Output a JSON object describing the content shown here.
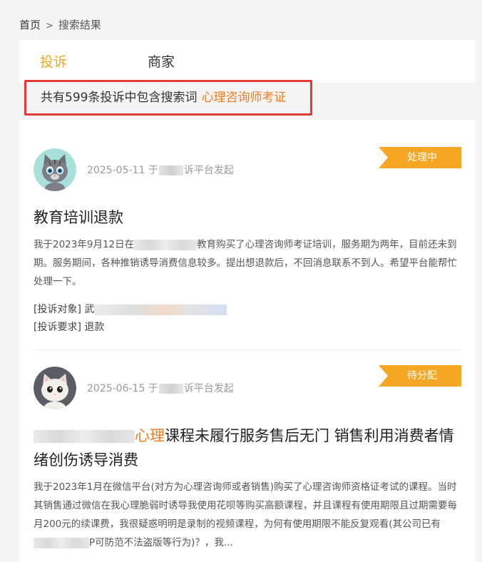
{
  "breadcrumb": {
    "home": "首页",
    "separator": ">",
    "current": "搜索结果"
  },
  "tabs": [
    {
      "label": "投诉",
      "active": true
    },
    {
      "label": "商家",
      "active": false
    }
  ],
  "summary": {
    "text": "共有599条投诉中包含搜索词",
    "keyword": "心理咨询师考证"
  },
  "colors": {
    "accent": "#f5a623",
    "keyword": "#f47c1e",
    "highlight_border": "#e53935"
  },
  "complaints": [
    {
      "avatar_icon": "cat-avatar-gray-icon",
      "date": "2025-05-11",
      "meta_prefix": "于",
      "meta_suffix": "诉平台发起",
      "status": "处理中",
      "title": "教育培训退款",
      "desc_part1": "我于2023年9月12日在",
      "desc_part2": "教育购买了心理咨询师考证培训，服务期为两年，目前还未到期。服务期间，各种推销诱导消费信息较多。提出想退款后，不回消息联系不到人。希望平台能帮忙处理一下。",
      "target_label": "[投诉对象]",
      "target_value": "武",
      "request_label": "[投诉要求]",
      "request_value": "退款"
    },
    {
      "avatar_icon": "cat-avatar-white-icon",
      "date": "2025-06-15",
      "meta_prefix": "于",
      "meta_suffix": "诉平台发起",
      "status": "待分配",
      "title_highlight": "心理",
      "title_rest": "课程未履行服务售后无门 销售利用消费者情绪创伤诱导消费",
      "desc_part1": "我于2023年1月在微信平台(对方为心理咨询师或者销售)购买了心理咨询师资格证考试的课程。当时其销售通过微信在我心理脆弱时诱导我使用花呗等购买高额课程，并且课程有使用期限且过期需要每月200元的续课费，我很疑惑明明是录制的视频课程，为何有使用期限不能反复观看(其公司已有",
      "desc_part2": "P可防范不法盗版等行为)？，我..."
    }
  ]
}
